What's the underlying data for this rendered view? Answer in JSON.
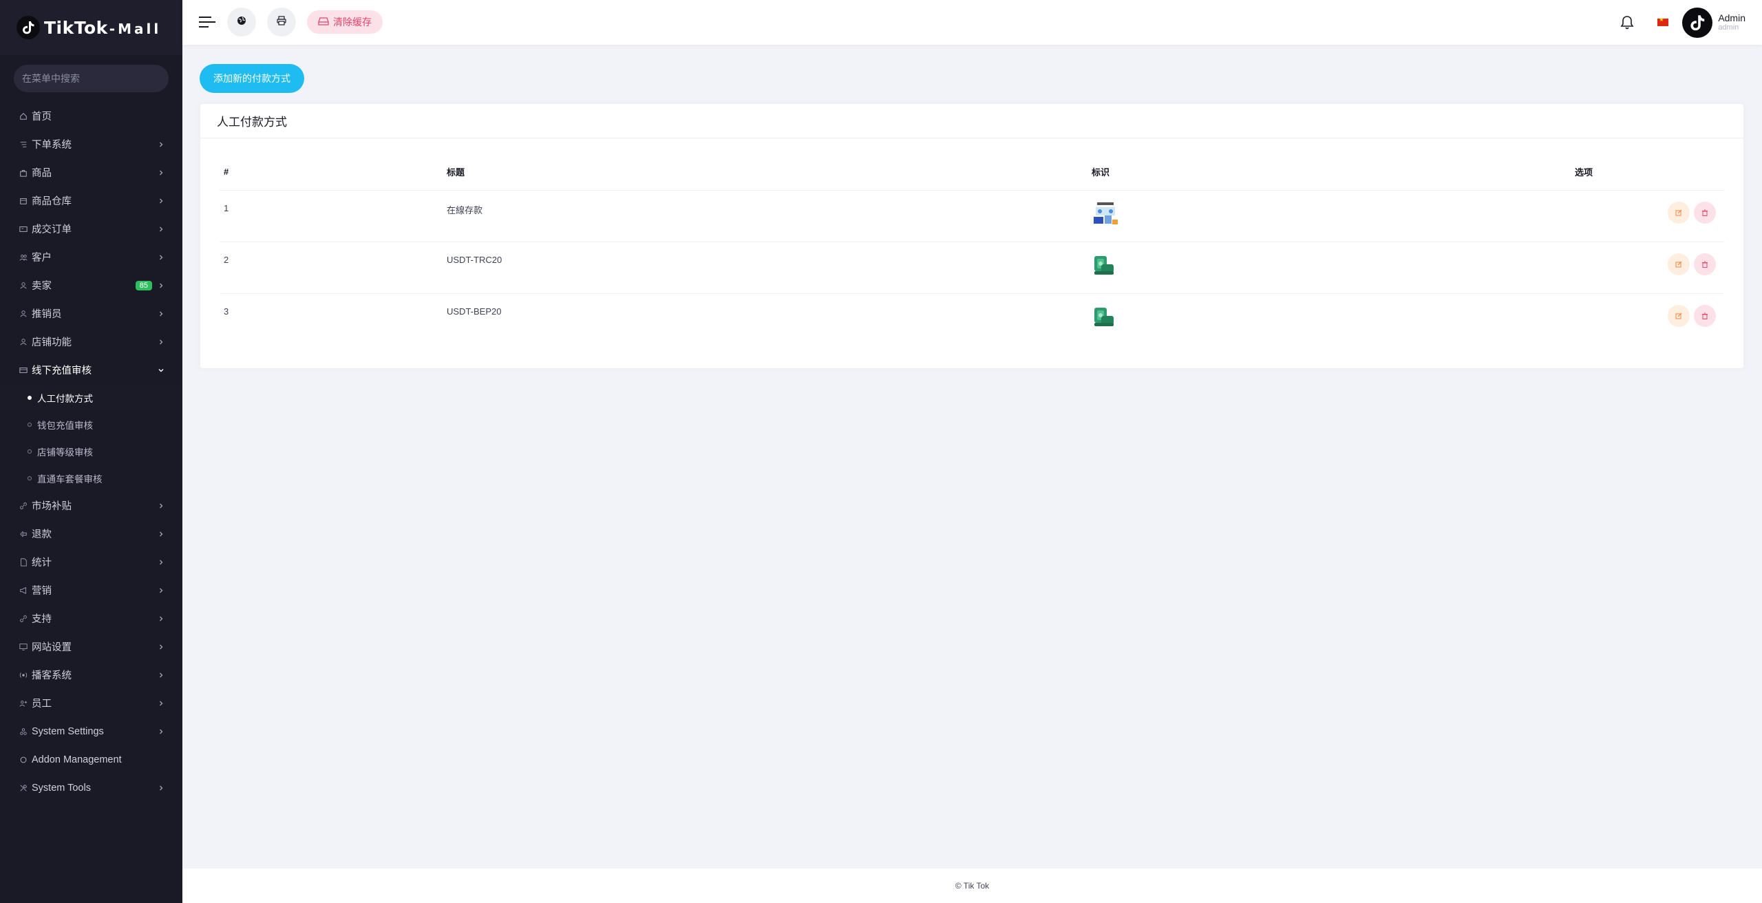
{
  "brand": {
    "name": "TikTok",
    "suffix": "-Mall"
  },
  "sidebar": {
    "search_placeholder": "在菜单中搜索",
    "items": [
      {
        "label": "首页",
        "icon": "home-icon",
        "has_chevron": false
      },
      {
        "label": "下单系统",
        "icon": "list-icon",
        "has_chevron": true
      },
      {
        "label": "商品",
        "icon": "bag-icon",
        "has_chevron": true
      },
      {
        "label": "商品仓库",
        "icon": "warehouse-icon",
        "has_chevron": true
      },
      {
        "label": "成交订单",
        "icon": "order-icon",
        "has_chevron": true
      },
      {
        "label": "客户",
        "icon": "users-icon",
        "has_chevron": true
      },
      {
        "label": "卖家",
        "icon": "user-icon",
        "has_chevron": true,
        "badge": "85"
      },
      {
        "label": "推销员",
        "icon": "user-icon",
        "has_chevron": true
      },
      {
        "label": "店铺功能",
        "icon": "user-icon",
        "has_chevron": true
      },
      {
        "label": "线下充值审核",
        "icon": "card-icon",
        "has_chevron": true,
        "open": true
      },
      {
        "label": "市场补贴",
        "icon": "link-icon",
        "has_chevron": true
      },
      {
        "label": "退款",
        "icon": "refund-icon",
        "has_chevron": true
      },
      {
        "label": "统计",
        "icon": "file-icon",
        "has_chevron": true
      },
      {
        "label": "营销",
        "icon": "megaphone-icon",
        "has_chevron": true
      },
      {
        "label": "支持",
        "icon": "link-icon",
        "has_chevron": true
      },
      {
        "label": "网站设置",
        "icon": "monitor-icon",
        "has_chevron": true
      },
      {
        "label": "播客系统",
        "icon": "broadcast-icon",
        "has_chevron": true
      },
      {
        "label": "员工",
        "icon": "staff-icon",
        "has_chevron": true
      },
      {
        "label": "System Settings",
        "icon": "settings-icon",
        "has_chevron": true
      },
      {
        "label": "Addon Management",
        "icon": "addon-icon",
        "has_chevron": false
      },
      {
        "label": "System Tools",
        "icon": "tools-icon",
        "has_chevron": true
      }
    ],
    "submenu": [
      {
        "label": "人工付款方式",
        "active": true
      },
      {
        "label": "钱包充值审核",
        "active": false
      },
      {
        "label": "店铺等级审核",
        "active": false
      },
      {
        "label": "直通车套餐审核",
        "active": false
      }
    ]
  },
  "header": {
    "clear_cache_label": "清除缓存",
    "user_name": "Admin",
    "user_role": "admin",
    "language_flag": "cn-flag-icon"
  },
  "page": {
    "add_button_label": "添加新的付款方式",
    "card_title": "人工付款方式",
    "table": {
      "headers": [
        "#",
        "标题",
        "标识",
        "选项"
      ],
      "rows": [
        {
          "num": "1",
          "title": "在線存款",
          "logo": "bank-deposit-logo"
        },
        {
          "num": "2",
          "title": "USDT-TRC20",
          "logo": "cash-stack-logo"
        },
        {
          "num": "3",
          "title": "USDT-BEP20",
          "logo": "cash-stack-logo"
        }
      ]
    }
  },
  "footer": {
    "text": "© Tik Tok"
  },
  "colors": {
    "accent": "#1ebcf0",
    "sidebar_bg": "#1a1a27",
    "badge_green": "#2ebd5f",
    "danger_soft": "#fde1e9",
    "warning_soft": "#fdeee0"
  }
}
